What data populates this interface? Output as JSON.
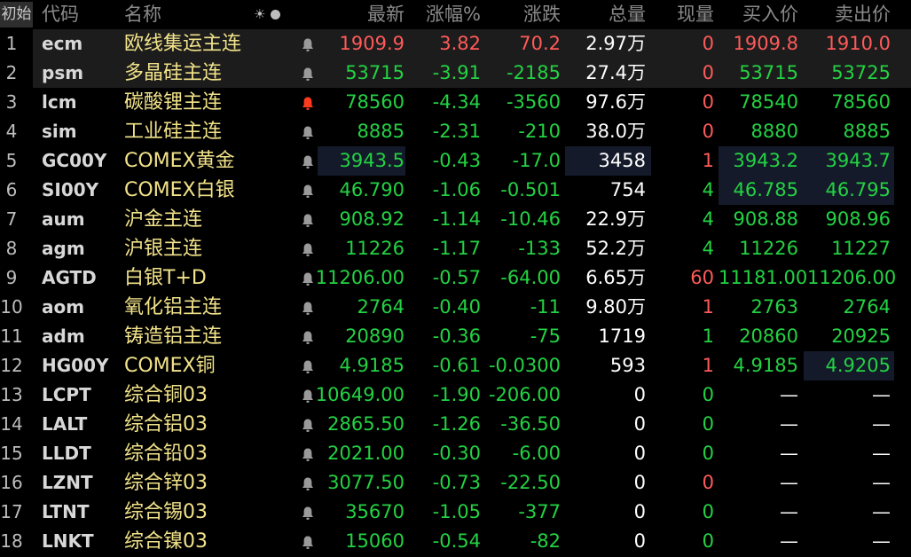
{
  "header": {
    "corner": "初始",
    "code": "代码",
    "name": "名称",
    "sun_icon": "☀",
    "price": "最新",
    "pct": "涨幅%",
    "chg": "涨跌",
    "vol": "总量",
    "cur": "现量",
    "bid": "买入价",
    "ask": "卖出价"
  },
  "colors": {
    "up": "#ff5a5a",
    "down": "#23d243",
    "name": "#f2e38a",
    "bell_active": "#ff3b1f",
    "bell": "#9a9a9a"
  },
  "rows": [
    {
      "idx": "1",
      "code": "ecm",
      "name": "欧线集运主连",
      "bell": "bell-icon",
      "price": "1909.9",
      "pct": "3.82",
      "chg": "70.2",
      "vol": "2.97",
      "vol_unit": "万",
      "cur": "0",
      "bid": "1909.8",
      "ask": "1910.0",
      "dir": "up",
      "cur_dir": "up",
      "sel": true
    },
    {
      "idx": "2",
      "code": "psm",
      "name": "多晶硅主连",
      "bell": "bell-icon",
      "price": "53715",
      "pct": "-3.91",
      "chg": "-2185",
      "vol": "27.4",
      "vol_unit": "万",
      "cur": "0",
      "bid": "53715",
      "ask": "53725",
      "dir": "dn",
      "cur_dir": "up",
      "sel": true
    },
    {
      "idx": "3",
      "code": "lcm",
      "name": "碳酸锂主连",
      "bell": "bell-icon-active",
      "price": "78560",
      "pct": "-4.34",
      "chg": "-3560",
      "vol": "97.6",
      "vol_unit": "万",
      "cur": "0",
      "bid": "78540",
      "ask": "78560",
      "dir": "dn",
      "cur_dir": "up"
    },
    {
      "idx": "4",
      "code": "sim",
      "name": "工业硅主连",
      "bell": "bell-icon",
      "price": "8885",
      "pct": "-2.31",
      "chg": "-210",
      "vol": "38.0",
      "vol_unit": "万",
      "cur": "0",
      "bid": "8880",
      "ask": "8885",
      "dir": "dn",
      "cur_dir": "up"
    },
    {
      "idx": "5",
      "code": "GC00Y",
      "name": "COMEX黄金",
      "bell": "bell-icon",
      "price": "3943.5",
      "pct": "-0.43",
      "chg": "-17.0",
      "vol": "3458",
      "vol_unit": "",
      "cur": "1",
      "bid": "3943.2",
      "ask": "3943.7",
      "dir": "dn",
      "cur_dir": "up",
      "hl": [
        "price",
        "vol",
        "bidask"
      ]
    },
    {
      "idx": "6",
      "code": "SI00Y",
      "name": "COMEX白银",
      "bell": "bell-icon",
      "price": "46.790",
      "pct": "-1.06",
      "chg": "-0.501",
      "vol": "754",
      "vol_unit": "",
      "cur": "4",
      "bid": "46.785",
      "ask": "46.795",
      "dir": "dn",
      "cur_dir": "dn",
      "hl": [
        "bidask"
      ]
    },
    {
      "idx": "7",
      "code": "aum",
      "name": "沪金主连",
      "bell": "bell-icon",
      "price": "908.92",
      "pct": "-1.14",
      "chg": "-10.46",
      "vol": "22.9",
      "vol_unit": "万",
      "cur": "4",
      "bid": "908.88",
      "ask": "908.96",
      "dir": "dn",
      "cur_dir": "dn"
    },
    {
      "idx": "8",
      "code": "agm",
      "name": "沪银主连",
      "bell": "bell-icon",
      "price": "11226",
      "pct": "-1.17",
      "chg": "-133",
      "vol": "52.2",
      "vol_unit": "万",
      "cur": "4",
      "bid": "11226",
      "ask": "11227",
      "dir": "dn",
      "cur_dir": "dn"
    },
    {
      "idx": "9",
      "code": "AGTD",
      "name": "白银T+D",
      "bell": "bell-icon",
      "price": "11206.00",
      "pct": "-0.57",
      "chg": "-64.00",
      "vol": "6.65",
      "vol_unit": "万",
      "cur": "60",
      "bid": "11181.00",
      "ask": "11206.00",
      "dir": "dn",
      "cur_dir": "up"
    },
    {
      "idx": "10",
      "code": "aom",
      "name": "氧化铝主连",
      "bell": "bell-icon",
      "price": "2764",
      "pct": "-0.40",
      "chg": "-11",
      "vol": "9.80",
      "vol_unit": "万",
      "cur": "1",
      "bid": "2763",
      "ask": "2764",
      "dir": "dn",
      "cur_dir": "up"
    },
    {
      "idx": "11",
      "code": "adm",
      "name": "铸造铝主连",
      "bell": "bell-icon",
      "price": "20890",
      "pct": "-0.36",
      "chg": "-75",
      "vol": "1719",
      "vol_unit": "",
      "cur": "1",
      "bid": "20860",
      "ask": "20925",
      "dir": "dn",
      "cur_dir": "dn"
    },
    {
      "idx": "12",
      "code": "HG00Y",
      "name": "COMEX铜",
      "bell": "bell-icon",
      "price": "4.9185",
      "pct": "-0.61",
      "chg": "-0.0300",
      "vol": "593",
      "vol_unit": "",
      "cur": "1",
      "bid": "4.9185",
      "ask": "4.9205",
      "dir": "dn",
      "cur_dir": "up",
      "hl": [
        "ask"
      ]
    },
    {
      "idx": "13",
      "code": "LCPT",
      "name": "综合铜03",
      "bell": "bell-icon",
      "price": "10649.00",
      "pct": "-1.90",
      "chg": "-206.00",
      "vol": "0",
      "vol_unit": "",
      "cur": "0",
      "bid": "—",
      "ask": "—",
      "dir": "dn",
      "cur_dir": "dn"
    },
    {
      "idx": "14",
      "code": "LALT",
      "name": "综合铝03",
      "bell": "bell-icon",
      "price": "2865.50",
      "pct": "-1.26",
      "chg": "-36.50",
      "vol": "0",
      "vol_unit": "",
      "cur": "0",
      "bid": "—",
      "ask": "—",
      "dir": "dn",
      "cur_dir": "dn"
    },
    {
      "idx": "15",
      "code": "LLDT",
      "name": "综合铅03",
      "bell": "bell-icon",
      "price": "2021.00",
      "pct": "-0.30",
      "chg": "-6.00",
      "vol": "0",
      "vol_unit": "",
      "cur": "0",
      "bid": "—",
      "ask": "—",
      "dir": "dn",
      "cur_dir": "dn"
    },
    {
      "idx": "16",
      "code": "LZNT",
      "name": "综合锌03",
      "bell": "bell-icon",
      "price": "3077.50",
      "pct": "-0.73",
      "chg": "-22.50",
      "vol": "0",
      "vol_unit": "",
      "cur": "0",
      "bid": "—",
      "ask": "—",
      "dir": "dn",
      "cur_dir": "up"
    },
    {
      "idx": "17",
      "code": "LTNT",
      "name": "综合锡03",
      "bell": "bell-icon",
      "price": "35670",
      "pct": "-1.05",
      "chg": "-377",
      "vol": "0",
      "vol_unit": "",
      "cur": "0",
      "bid": "—",
      "ask": "—",
      "dir": "dn",
      "cur_dir": "dn"
    },
    {
      "idx": "18",
      "code": "LNKT",
      "name": "综合镍03",
      "bell": "bell-icon",
      "price": "15060",
      "pct": "-0.54",
      "chg": "-82",
      "vol": "0",
      "vol_unit": "",
      "cur": "0",
      "bid": "—",
      "ask": "—",
      "dir": "dn",
      "cur_dir": "dn"
    }
  ]
}
